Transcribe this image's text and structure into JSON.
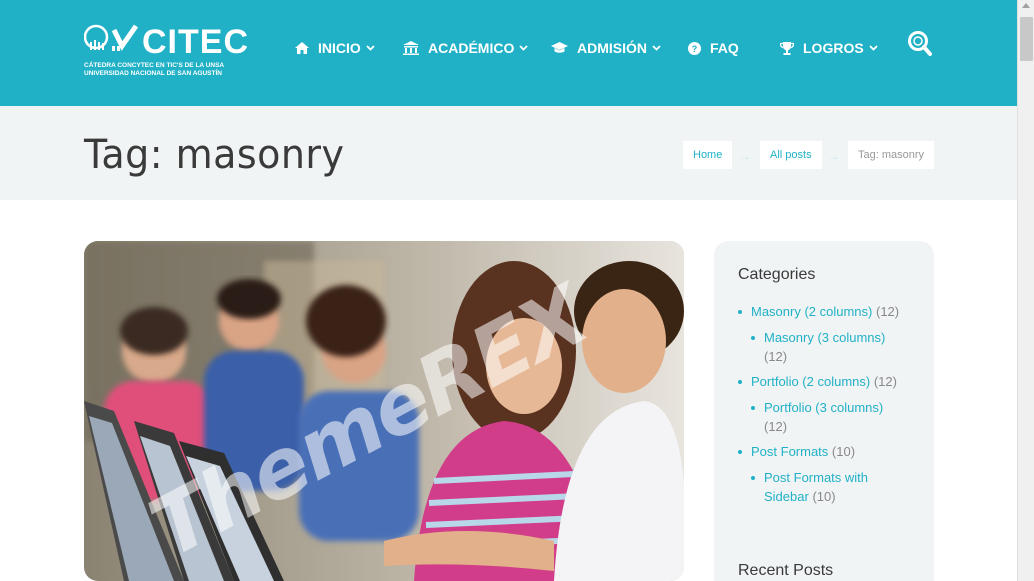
{
  "logo": {
    "title": "CITEC",
    "subtitle_line1": "CÁTEDRA CONCYTEC EN TIC'S DE LA UNSA",
    "subtitle_line2": "UNIVERSIDAD NACIONAL DE SAN AGUSTÍN"
  },
  "nav": {
    "items": [
      {
        "label": "INICIO",
        "icon": "home-icon",
        "has_dropdown": true
      },
      {
        "label": "ACADÉMICO",
        "icon": "bank-icon",
        "has_dropdown": true
      },
      {
        "label": "ADMISIÓN",
        "icon": "graduation-cap-icon",
        "has_dropdown": true
      },
      {
        "label": "FAQ",
        "icon": "question-circle-icon",
        "has_dropdown": false
      },
      {
        "label": "LOGROS",
        "icon": "trophy-icon",
        "has_dropdown": true
      }
    ],
    "search_icon": "search-icon"
  },
  "page": {
    "title": "Tag: masonry"
  },
  "breadcrumb": {
    "items": [
      "Home",
      "All posts",
      "Tag: masonry"
    ],
    "separator": "→"
  },
  "post": {
    "watermark": "ThemeREX"
  },
  "sidebar": {
    "categories_title": "Categories",
    "categories": [
      {
        "name": "Masonry (2 columns)",
        "count": "(12)"
      },
      {
        "name": "Masonry (3 columns)",
        "count": "(12)"
      },
      {
        "name": "Portfolio (2 columns)",
        "count": "(12)"
      },
      {
        "name": "Portfolio (3 columns)",
        "count": "(12)"
      },
      {
        "name": "Post Formats",
        "count": "(10)"
      },
      {
        "name_line1": "Post Formats with",
        "name_line2": "Sidebar",
        "count": "(10)"
      }
    ],
    "recent_title": "Recent Posts"
  },
  "colors": {
    "accent": "#21b1c7",
    "light_bg": "#f1f4f5",
    "text": "#3a3a3a"
  }
}
